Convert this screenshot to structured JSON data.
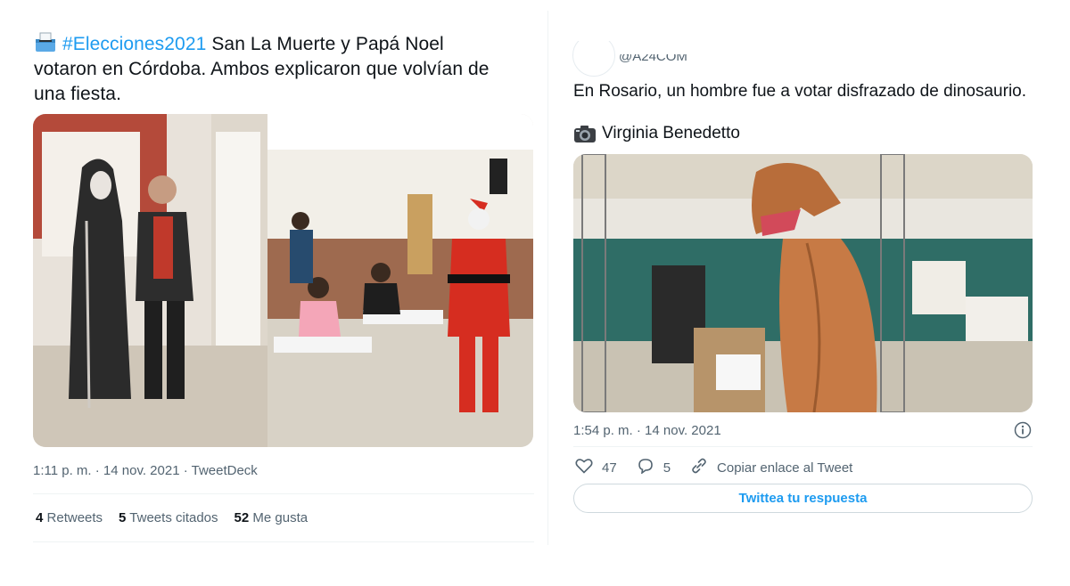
{
  "tweet_left": {
    "hashtag": "#Elecciones2021",
    "text_line1_rest": " San La Muerte y Papá Noel",
    "text_line2": "votaron en Córdoba. Ambos explicaron que volvían de",
    "text_line3": "una fiesta.",
    "timestamp": "1:11 p. m. · 14 nov. 2021 · TweetDeck",
    "stats": [
      {
        "count": "4",
        "label": "Retweets"
      },
      {
        "count": "5",
        "label": "Tweets citados"
      },
      {
        "count": "52",
        "label": "Me gusta"
      }
    ]
  },
  "tweet_right": {
    "handle": "@A24COM",
    "text": "En Rosario, un hombre fue a votar disfrazado de dinosaurio.",
    "credit": "Virginia Benedetto",
    "timestamp": "1:54 p. m. · 14 nov. 2021",
    "likes": "47",
    "replies": "5",
    "copy_link": "Copiar enlace al Tweet",
    "reply_button": "Twittea tu respuesta"
  },
  "colors": {
    "accent": "#1d9bf0",
    "secondary_text": "#536471",
    "divider": "#eff3f4"
  },
  "icons": [
    "ballot-box-icon",
    "camera-icon",
    "heart-icon",
    "reply-icon",
    "link-icon",
    "info-icon"
  ]
}
